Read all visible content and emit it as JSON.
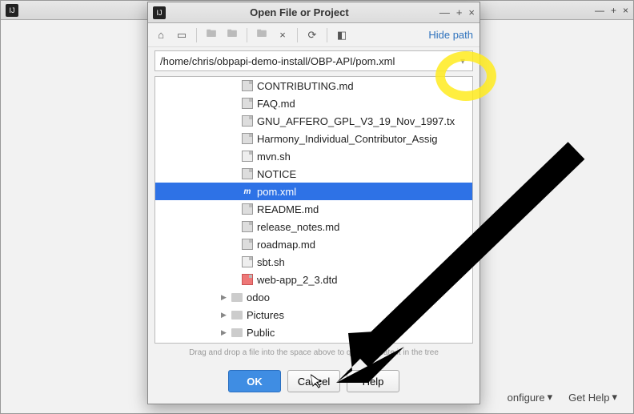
{
  "backWindow": {
    "bottomLinks": [
      "onfigure",
      "Get Help"
    ]
  },
  "dialog": {
    "title": "Open File or Project",
    "hidePath": "Hide path",
    "path": "/home/chris/obpapi-demo-install/OBP-API/pom.xml",
    "files": [
      {
        "name": "CONTRIBUTING.md",
        "icon": "file"
      },
      {
        "name": "FAQ.md",
        "icon": "file"
      },
      {
        "name": "GNU_AFFERO_GPL_V3_19_Nov_1997.tx",
        "icon": "file"
      },
      {
        "name": "Harmony_Individual_Contributor_Assig",
        "icon": "file"
      },
      {
        "name": "mvn.sh",
        "icon": "sh"
      },
      {
        "name": "NOTICE",
        "icon": "file"
      },
      {
        "name": "pom.xml",
        "icon": "m",
        "selected": true
      },
      {
        "name": "README.md",
        "icon": "file"
      },
      {
        "name": "release_notes.md",
        "icon": "file"
      },
      {
        "name": "roadmap.md",
        "icon": "file"
      },
      {
        "name": "sbt.sh",
        "icon": "sh"
      },
      {
        "name": "web-app_2_3.dtd",
        "icon": "dtd"
      }
    ],
    "folders": [
      {
        "name": "odoo"
      },
      {
        "name": "Pictures"
      },
      {
        "name": "Public"
      }
    ],
    "hint": "Drag and drop a file into the space above to quickly locate it in the tree",
    "buttons": {
      "ok": "OK",
      "cancel": "Cancel",
      "help": "Help"
    }
  }
}
